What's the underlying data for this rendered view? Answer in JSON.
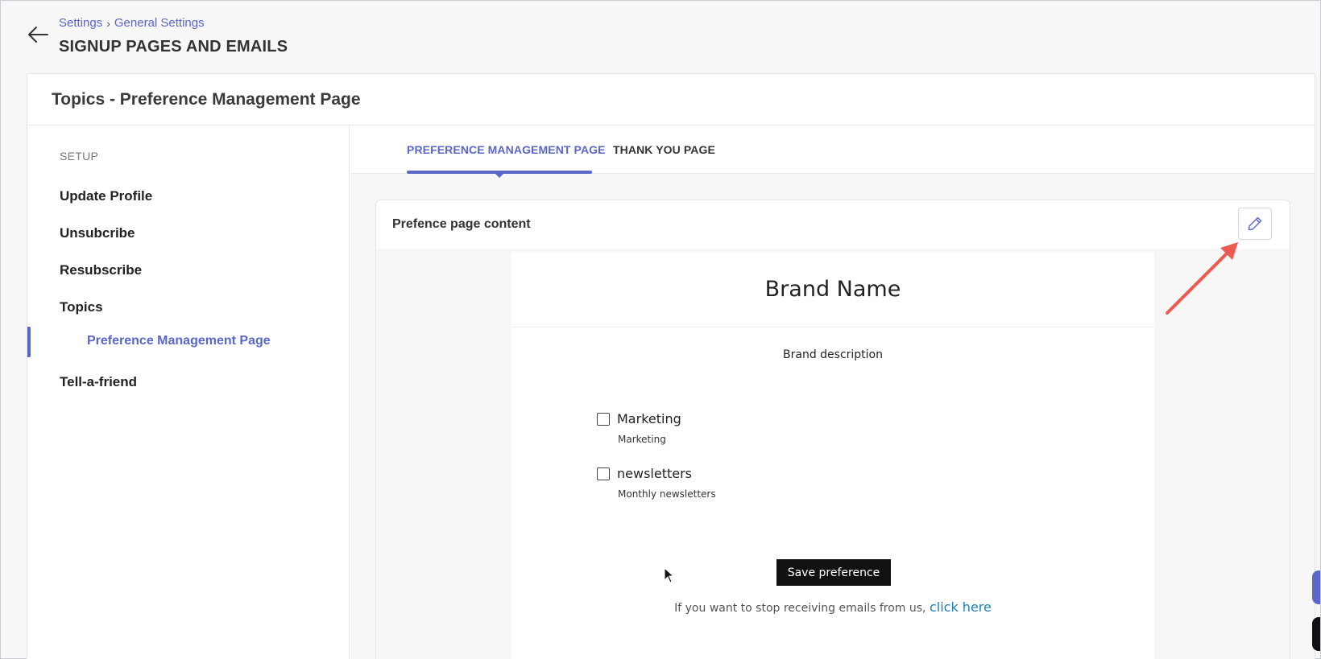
{
  "header": {
    "breadcrumb": [
      "Settings",
      "General Settings"
    ],
    "breadcrumb_sep": "›",
    "title": "SIGNUP PAGES AND EMAILS"
  },
  "card": {
    "title": "Topics - Preference Management Page"
  },
  "sidebar": {
    "section_label": "SETUP",
    "items": [
      {
        "label": "Update Profile"
      },
      {
        "label": "Unsubcribe"
      },
      {
        "label": "Resubscribe"
      },
      {
        "label": "Topics"
      },
      {
        "label": "Preference Management Page",
        "active": true
      },
      {
        "label": "Tell-a-friend"
      }
    ]
  },
  "tabs": [
    {
      "label": "PREFERENCE MANAGEMENT PAGE",
      "active": true
    },
    {
      "label": "THANK YOU PAGE",
      "active": false
    }
  ],
  "panel": {
    "title": "Prefence page content",
    "edit_icon": "pencil-icon"
  },
  "preview": {
    "brand_name": "Brand Name",
    "brand_description": "Brand description",
    "topics": [
      {
        "name": "Marketing",
        "description": "Marketing",
        "checked": false
      },
      {
        "name": "newsletters",
        "description": "Monthly newsletters",
        "checked": false
      }
    ],
    "save_label": "Save preference",
    "unsubscribe_text": "If you want to stop receiving emails from us,",
    "unsubscribe_link": "click here"
  },
  "colors": {
    "accent": "#5867c8",
    "link": "#1f80b5",
    "annotation": "#ee5a4f"
  }
}
